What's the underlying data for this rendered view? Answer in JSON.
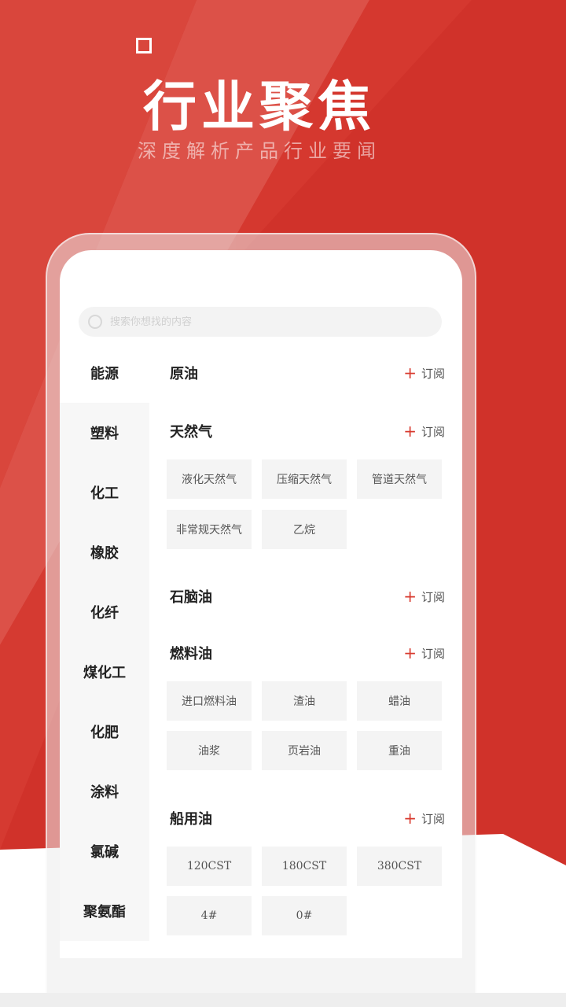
{
  "hero": {
    "title": "行业聚焦",
    "subtitle": "深度解析产品行业要闻"
  },
  "colors": {
    "accent": "#d83a2e",
    "brand_red": "#d0322a"
  },
  "search": {
    "placeholder": "搜索你想找的内容"
  },
  "sidebar": {
    "items": [
      {
        "label": "能源",
        "active": true
      },
      {
        "label": "塑料"
      },
      {
        "label": "化工"
      },
      {
        "label": "橡胶"
      },
      {
        "label": "化纤"
      },
      {
        "label": "煤化工"
      },
      {
        "label": "化肥"
      },
      {
        "label": "涂料"
      },
      {
        "label": "氯碱"
      },
      {
        "label": "聚氨酯"
      }
    ]
  },
  "subscribe_label": "订阅",
  "categories": [
    {
      "name": "原油",
      "chips": []
    },
    {
      "name": "天然气",
      "chips": [
        "液化天然气",
        "压缩天然气",
        "管道天然气",
        "非常规天然气",
        "乙烷"
      ]
    },
    {
      "name": "石脑油",
      "chips": []
    },
    {
      "name": "燃料油",
      "chips": [
        "进口燃料油",
        "渣油",
        "蜡油",
        "油浆",
        "页岩油",
        "重油"
      ]
    },
    {
      "name": "船用油",
      "chips": [
        "120CST",
        "180CST",
        "380CST",
        "4#",
        "0#"
      ]
    }
  ]
}
